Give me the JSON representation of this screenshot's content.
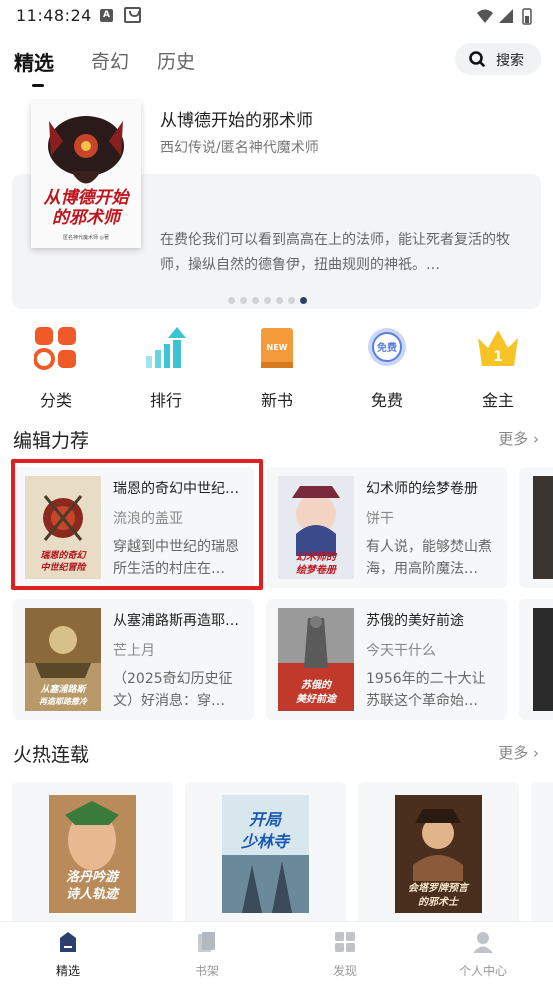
{
  "status_bar": {
    "time": "11:48:24",
    "a_badge": "A"
  },
  "top_tabs": [
    {
      "label": "精选",
      "active": true
    },
    {
      "label": "奇幻",
      "active": false
    },
    {
      "label": "历史",
      "active": false
    }
  ],
  "search": {
    "label": "搜索"
  },
  "carousel": {
    "title": "从博德开始的邪术师",
    "meta": "西幻传说/匿名神代魔术师",
    "description": "在费伦我们可以看到高高在上的法师，能让死者复活的牧师，操纵自然的德鲁伊，扭曲规则的神祇。…",
    "cover_text": "从博德开始的邪术师",
    "cover_subtext": "匿名神代魔术师 ◎著",
    "dots_total": 7,
    "active_dot": 7
  },
  "categories": [
    {
      "label": "分类",
      "icon": "category-grid-icon"
    },
    {
      "label": "排行",
      "icon": "ranking-bars-icon"
    },
    {
      "label": "新书",
      "icon": "new-book-icon",
      "badge": "NEW"
    },
    {
      "label": "免费",
      "icon": "free-badge-icon",
      "badge": "免费"
    },
    {
      "label": "金主",
      "icon": "crown-icon",
      "badge": "1"
    }
  ],
  "editor_section": {
    "title": "编辑力荐",
    "more": "更多"
  },
  "editor_books": [
    {
      "title": "瑞恩的奇幻中世纪…",
      "author": "流浪的盖亚",
      "desc": "穿越到中世纪的瑞恩所生活的村庄在…",
      "cover_text": "瑞恩的奇幻中世纪冒险"
    },
    {
      "title": "幻术师的绘梦卷册",
      "author": "饼干",
      "desc": "有人说，能够焚山煮海，用高阶魔法…",
      "cover_text": "幻术师的绘梦卷册"
    },
    {
      "title": "从塞浦路斯再造耶…",
      "author": "芒上月",
      "desc": "（2025奇幻历史征文）好消息：穿…",
      "cover_text": "从塞浦路斯再造耶路撒冷"
    },
    {
      "title": "苏俄的美好前途",
      "author": "今天干什么",
      "desc": "1956年的二十大让苏联这个革命始…",
      "cover_text": "苏俄的美好前途"
    }
  ],
  "hot_section": {
    "title": "火热连载",
    "more": "更多"
  },
  "hot_books": [
    {
      "cover_text": "洛丹吟游诗人轨迹"
    },
    {
      "cover_text": "开局 少林寺"
    },
    {
      "cover_text": "会塔罗牌预言的邪术士"
    }
  ],
  "bottom_nav": [
    {
      "label": "精选",
      "active": true,
      "icon": "featured-icon"
    },
    {
      "label": "书架",
      "active": false,
      "icon": "bookshelf-icon"
    },
    {
      "label": "发现",
      "active": false,
      "icon": "discover-icon"
    },
    {
      "label": "个人中心",
      "active": false,
      "icon": "profile-icon"
    }
  ],
  "colors": {
    "accent": "#2c3e6b",
    "highlight_border": "#e02020",
    "category_orange": "#f05a28",
    "category_teal": "#3cc4d4",
    "crown_gold": "#f7c325"
  }
}
